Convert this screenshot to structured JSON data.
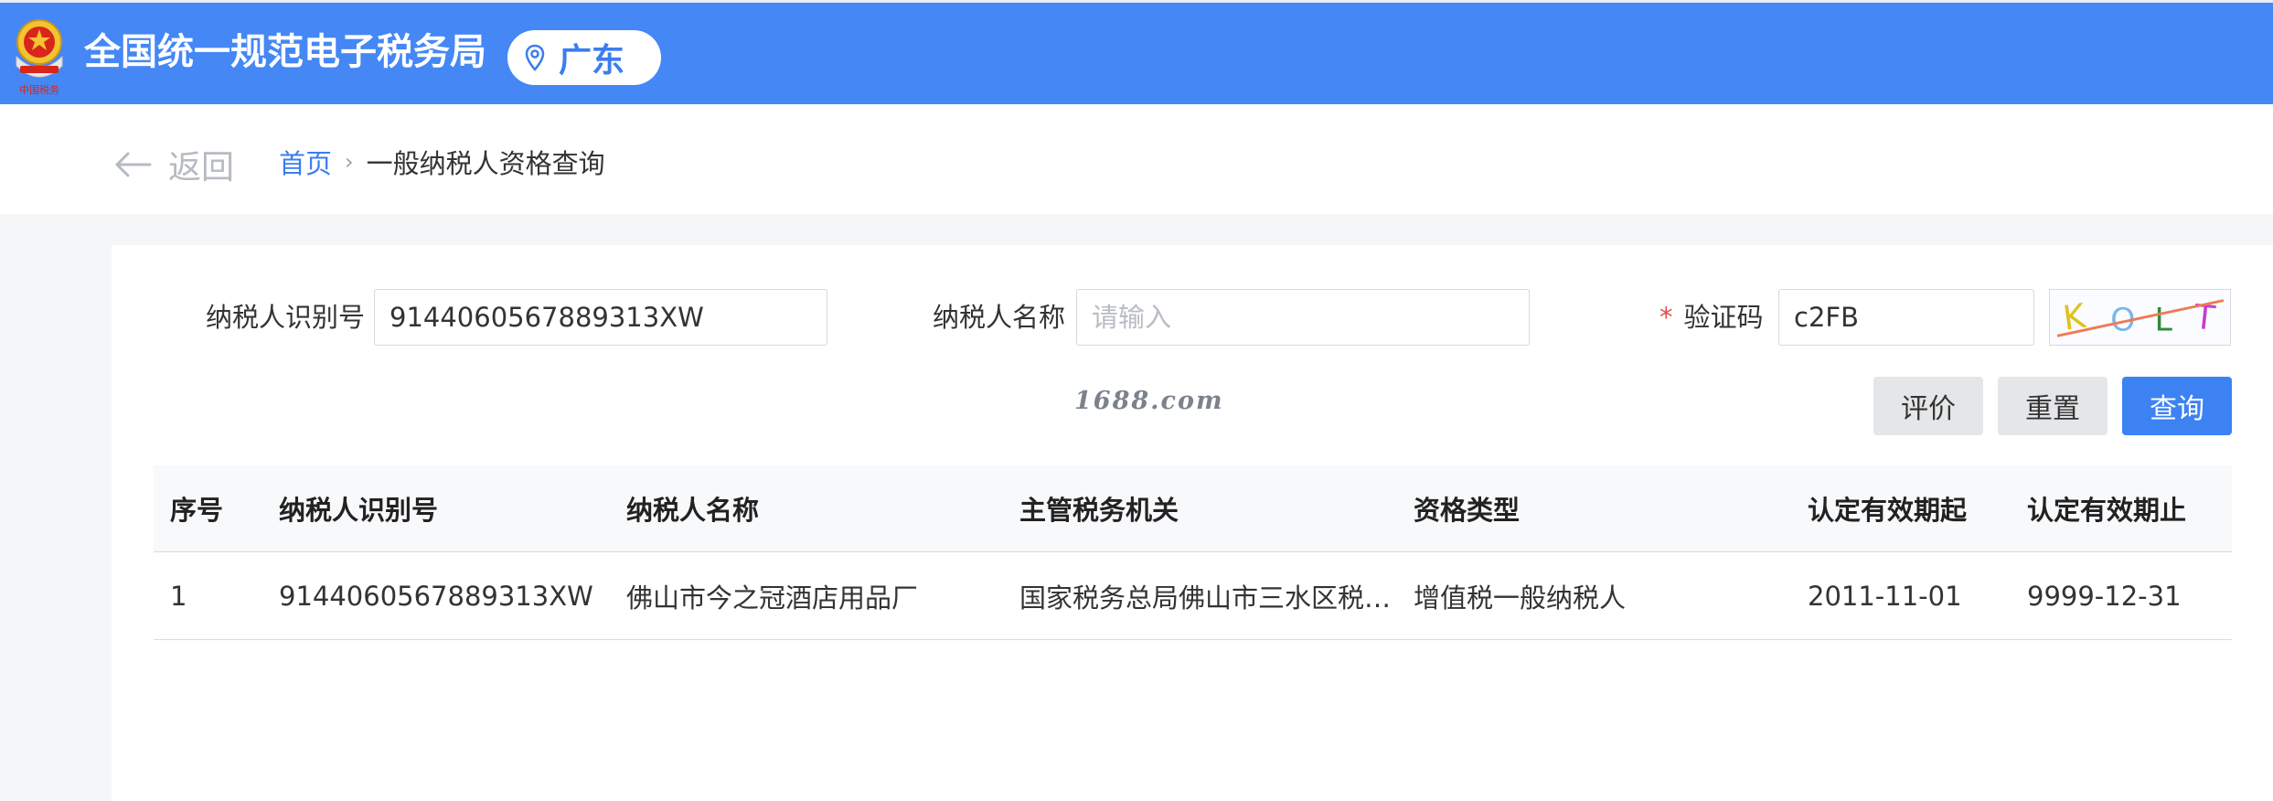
{
  "header": {
    "site_title": "全国统一规范电子税务局",
    "region": "广东",
    "emblem_caption": "中国税务"
  },
  "subnav": {
    "back_label": "返回",
    "breadcrumb_home": "首页",
    "breadcrumb_separator": "›",
    "breadcrumb_current": "一般纳税人资格查询"
  },
  "form": {
    "taxpayer_id_label": "纳税人识别号",
    "taxpayer_id_value": "9144060567889313XW",
    "taxpayer_name_label": "纳税人名称",
    "taxpayer_name_placeholder": "请输入",
    "captcha_required_mark": "*",
    "captcha_label": "验证码",
    "captcha_value": "c2FB",
    "captcha_image_text": [
      "K",
      "O",
      "L",
      "T"
    ]
  },
  "watermark": "1688.com",
  "buttons": {
    "rate_label": "评价",
    "reset_label": "重置",
    "query_label": "查询"
  },
  "table": {
    "columns": [
      "序号",
      "纳税人识别号",
      "纳税人名称",
      "主管税务机关",
      "资格类型",
      "认定有效期起",
      "认定有效期止"
    ],
    "rows": [
      [
        "1",
        "9144060567889313XW",
        "佛山市今之冠酒店用品厂",
        "国家税务总局佛山市三水区税…",
        "增值税一般纳税人",
        "2011-11-01",
        "9999-12-31"
      ]
    ]
  },
  "colors": {
    "header_blue": "#4487f5",
    "primary_button": "#3d82f3",
    "link_blue": "#3b7df0",
    "required_red": "#e34d4d"
  },
  "icons": {
    "region": "location-pin-icon",
    "back": "arrow-left-icon",
    "emblem": "national-emblem-icon"
  }
}
